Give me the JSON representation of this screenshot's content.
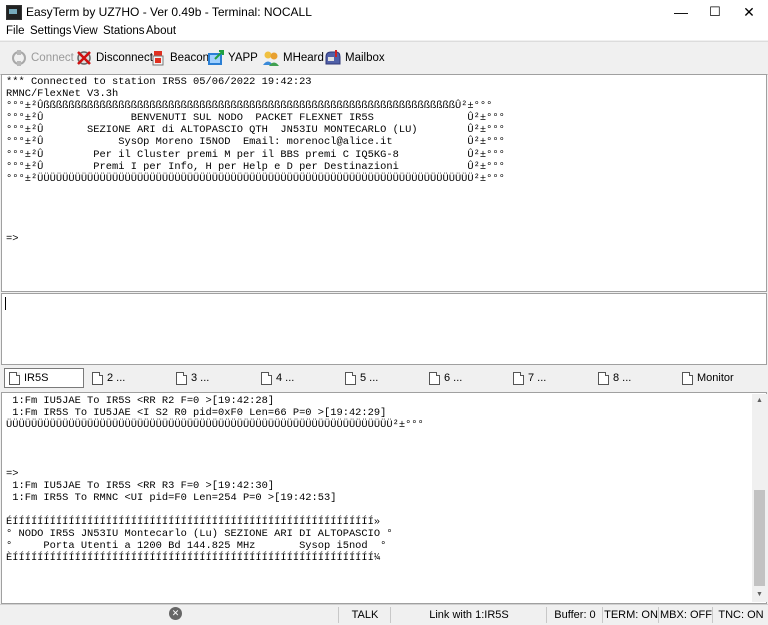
{
  "window": {
    "title": "EasyTerm by UZ7HO - Ver 0.49b - Terminal: NOCALL",
    "minimize": "—",
    "maximize": "☐",
    "close": "✕"
  },
  "menu": [
    "File",
    "Settings",
    "View",
    "Stations",
    "About"
  ],
  "toolbar": {
    "connect": "Connect",
    "disconnect": "Disconnect",
    "beacon": "Beacon",
    "yapp": "YAPP",
    "mheard": "MHeard",
    "mailbox": "Mailbox"
  },
  "terminal_top": [
    "*** Connected to station IR5S 05/06/2022 19:42:23",
    "RMNC/FlexNet V3.3h",
    "°°°±²ÛßßßßßßßßßßßßßßßßßßßßßßßßßßßßßßßßßßßßßßßßßßßßßßßßßßßßßßßßßßßßßßßßßßÛ²±°°°",
    "°°°±²Û              BENVENUTI SUL NODO  PACKET FLEXNET IR5S               Û²±°°°",
    "°°°±²Û       SEZIONE ARI di ALTOPASCIO QTH  JN53IU MONTECARLO (LU)        Û²±°°°",
    "°°°±²Û            SysOp Moreno I5NOD  Email: morenocl@alice.it            Û²±°°°",
    "°°°±²Û        Per il Cluster premi M per il BBS premi C IQ5KG-8           Û²±°°°",
    "°°°±²Û        Premi I per Info, H per Help e D per Destinazioni           Û²±°°°",
    "°°°±²ÜÜÜÜÜÜÜÜÜÜÜÜÜÜÜÜÜÜÜÜÜÜÜÜÜÜÜÜÜÜÜÜÜÜÜÜÜÜÜÜÜÜÜÜÜÜÜÜÜÜÜÜÜÜÜÜÜÜÜÜÜÜÜÜÜÜÜÜÜÜ²±°°°",
    "",
    "",
    "",
    "",
    "=>"
  ],
  "input_text": "",
  "tabs": [
    {
      "label": "IR5S"
    },
    {
      "label": "2 ..."
    },
    {
      "label": "3 ..."
    },
    {
      "label": "4 ..."
    },
    {
      "label": "5 ..."
    },
    {
      "label": "6 ..."
    },
    {
      "label": "7 ..."
    },
    {
      "label": "8 ..."
    },
    {
      "label": "Monitor"
    }
  ],
  "monitor_lines": [
    " 1:Fm IU5JAE To IR5S <RR R2 F=0 >[19:42:28]",
    " 1:Fm IR5S To IU5JAE <I S2 R0 pid=0xF0 Len=66 P=0 >[19:42:29]",
    "ÜÜÜÜÜÜÜÜÜÜÜÜÜÜÜÜÜÜÜÜÜÜÜÜÜÜÜÜÜÜÜÜÜÜÜÜÜÜÜÜÜÜÜÜÜÜÜÜÜÜÜÜÜÜÜÜÜÜÜÜÜÜ²±°°°",
    "",
    "",
    "",
    "=>",
    " 1:Fm IU5JAE To IR5S <RR R3 F=0 >[19:42:30]",
    " 1:Fm IR5S To RMNC <UI pid=F0 Len=254 P=0 >[19:42:53]",
    "",
    "ÉÍÍÍÍÍÍÍÍÍÍÍÍÍÍÍÍÍÍÍÍÍÍÍÍÍÍÍÍÍÍÍÍÍÍÍÍÍÍÍÍÍÍÍÍÍÍÍÍÍÍÍÍÍÍÍÍÍÍ»",
    "° NODO IR5S JN53IU Montecarlo (Lu) SEZIONE ARI DI ALTOPASCIO °",
    "°     Porta Utenti a 1200 Bd 144.825 MHz       Sysop i5nod  °",
    "ÈÍÍÍÍÍÍÍÍÍÍÍÍÍÍÍÍÍÍÍÍÍÍÍÍÍÍÍÍÍÍÍÍÍÍÍÍÍÍÍÍÍÍÍÍÍÍÍÍÍÍÍÍÍÍÍÍÍÍ¼"
  ],
  "status": {
    "talk": "TALK",
    "link": "Link with 1:IR5S",
    "buffer": "Buffer: 0",
    "term": "TERM: ON",
    "mbx": "MBX: OFF",
    "tnc": "TNC: ON"
  },
  "colors": {
    "window_bg": "#f0f0f0",
    "pane_bg": "#ffffff",
    "disabled_text": "#9a9a9a"
  }
}
